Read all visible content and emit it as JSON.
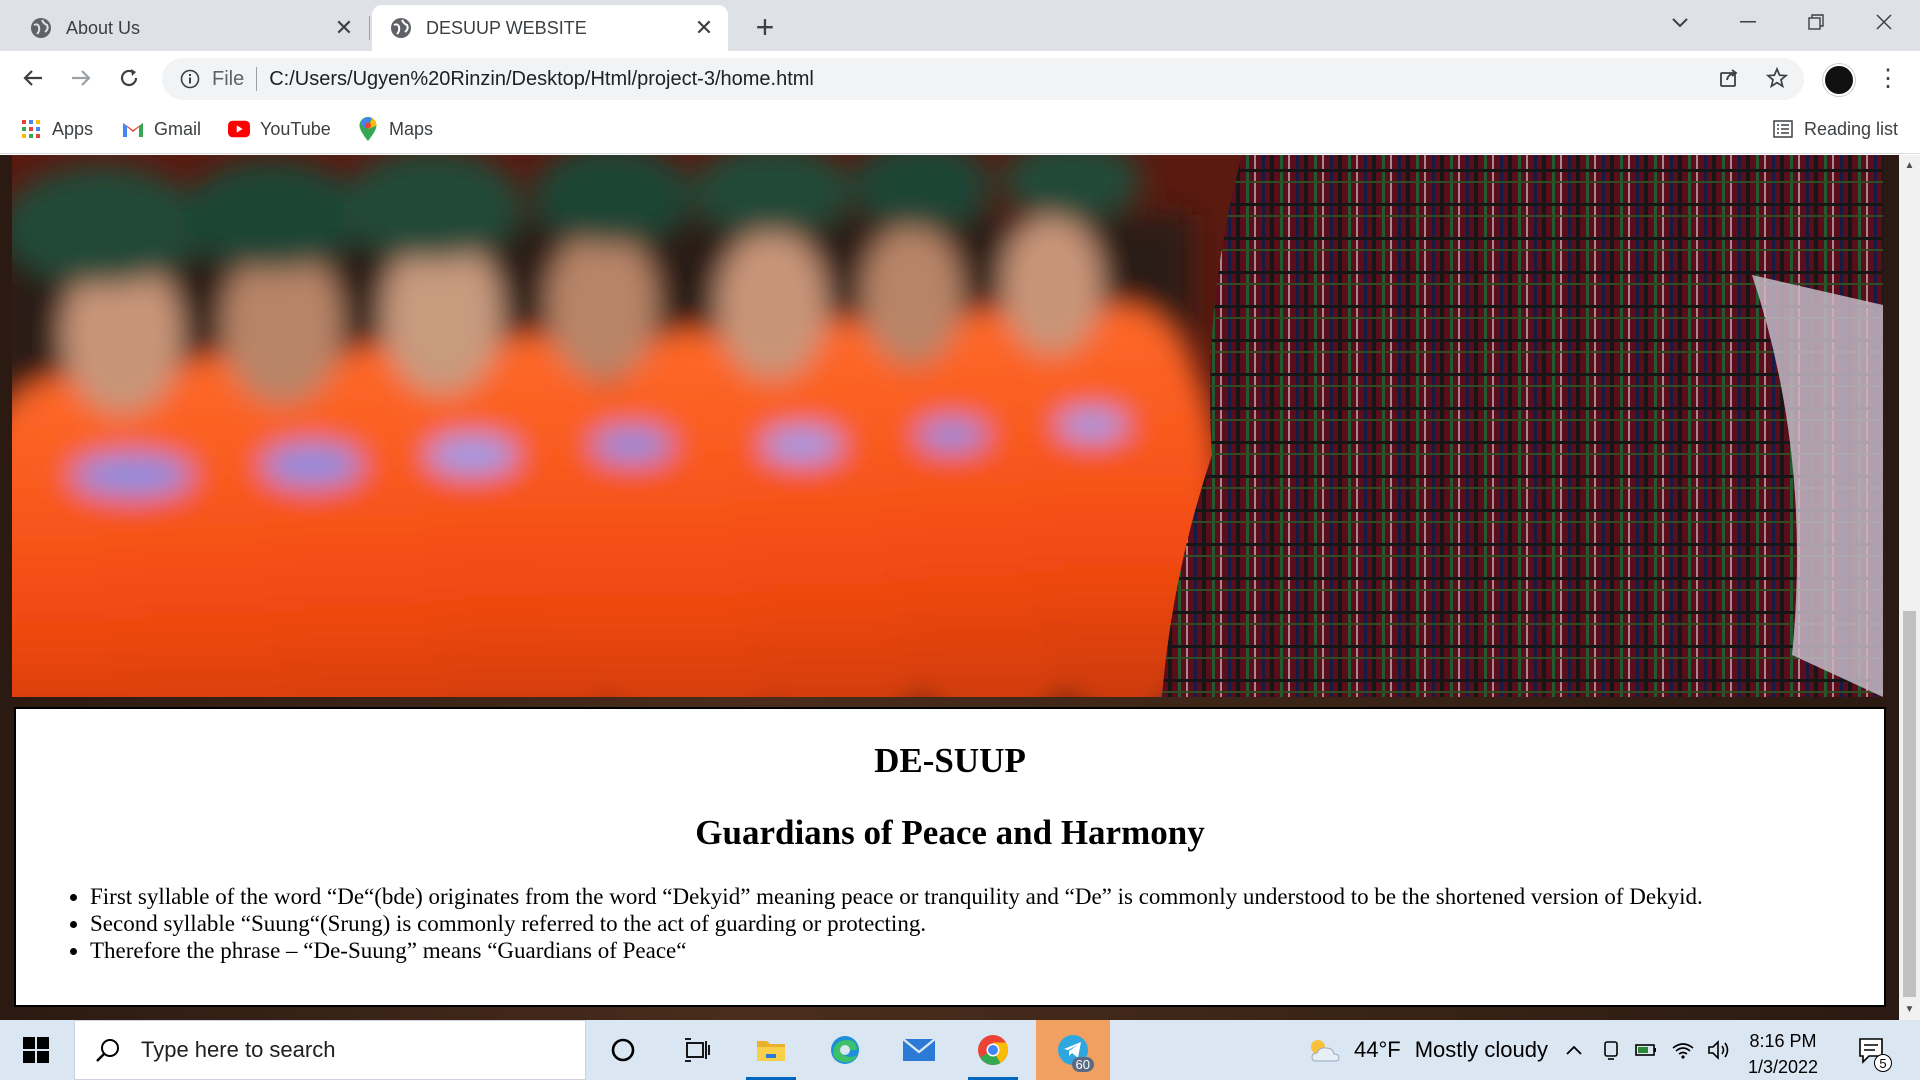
{
  "browser": {
    "tabs": [
      {
        "title": "About Us",
        "active": false
      },
      {
        "title": "DESUUP WEBSITE",
        "active": true
      }
    ],
    "address": {
      "scheme": "File",
      "url": "C:/Users/Ugyen%20Rinzin/Desktop/Html/project-3/home.html"
    },
    "bookmarks": [
      {
        "label": "Apps",
        "icon": "apps-grid-icon"
      },
      {
        "label": "Gmail",
        "icon": "gmail-icon"
      },
      {
        "label": "YouTube",
        "icon": "youtube-icon"
      },
      {
        "label": "Maps",
        "icon": "maps-icon"
      }
    ],
    "reading_list": "Reading list"
  },
  "page": {
    "heading": "DE-SUUP",
    "subheading": "Guardians of Peace and Harmony",
    "bullets": [
      "First syllable of the word “De“(bde) originates from the word “Dekyid” meaning peace or tranquility and “De” is commonly understood to be the shortened version of Dekyid.",
      "Second syllable “Suung“(Srung) is commonly referred to the act of guarding or protecting.",
      "Therefore the phrase – “De-Suung” means “Guardians of Peace“"
    ]
  },
  "taskbar": {
    "search_placeholder": "Type here to search",
    "telegram_badge": "60",
    "weather": {
      "temp": "44°F",
      "condition": "Mostly cloudy"
    },
    "time": "8:16 PM",
    "date": "1/3/2022",
    "notification_count": "5"
  },
  "colors": {
    "accent": "#0067c0",
    "tabstrip": "#dee1e6",
    "taskbar": "#dbe6f3"
  }
}
